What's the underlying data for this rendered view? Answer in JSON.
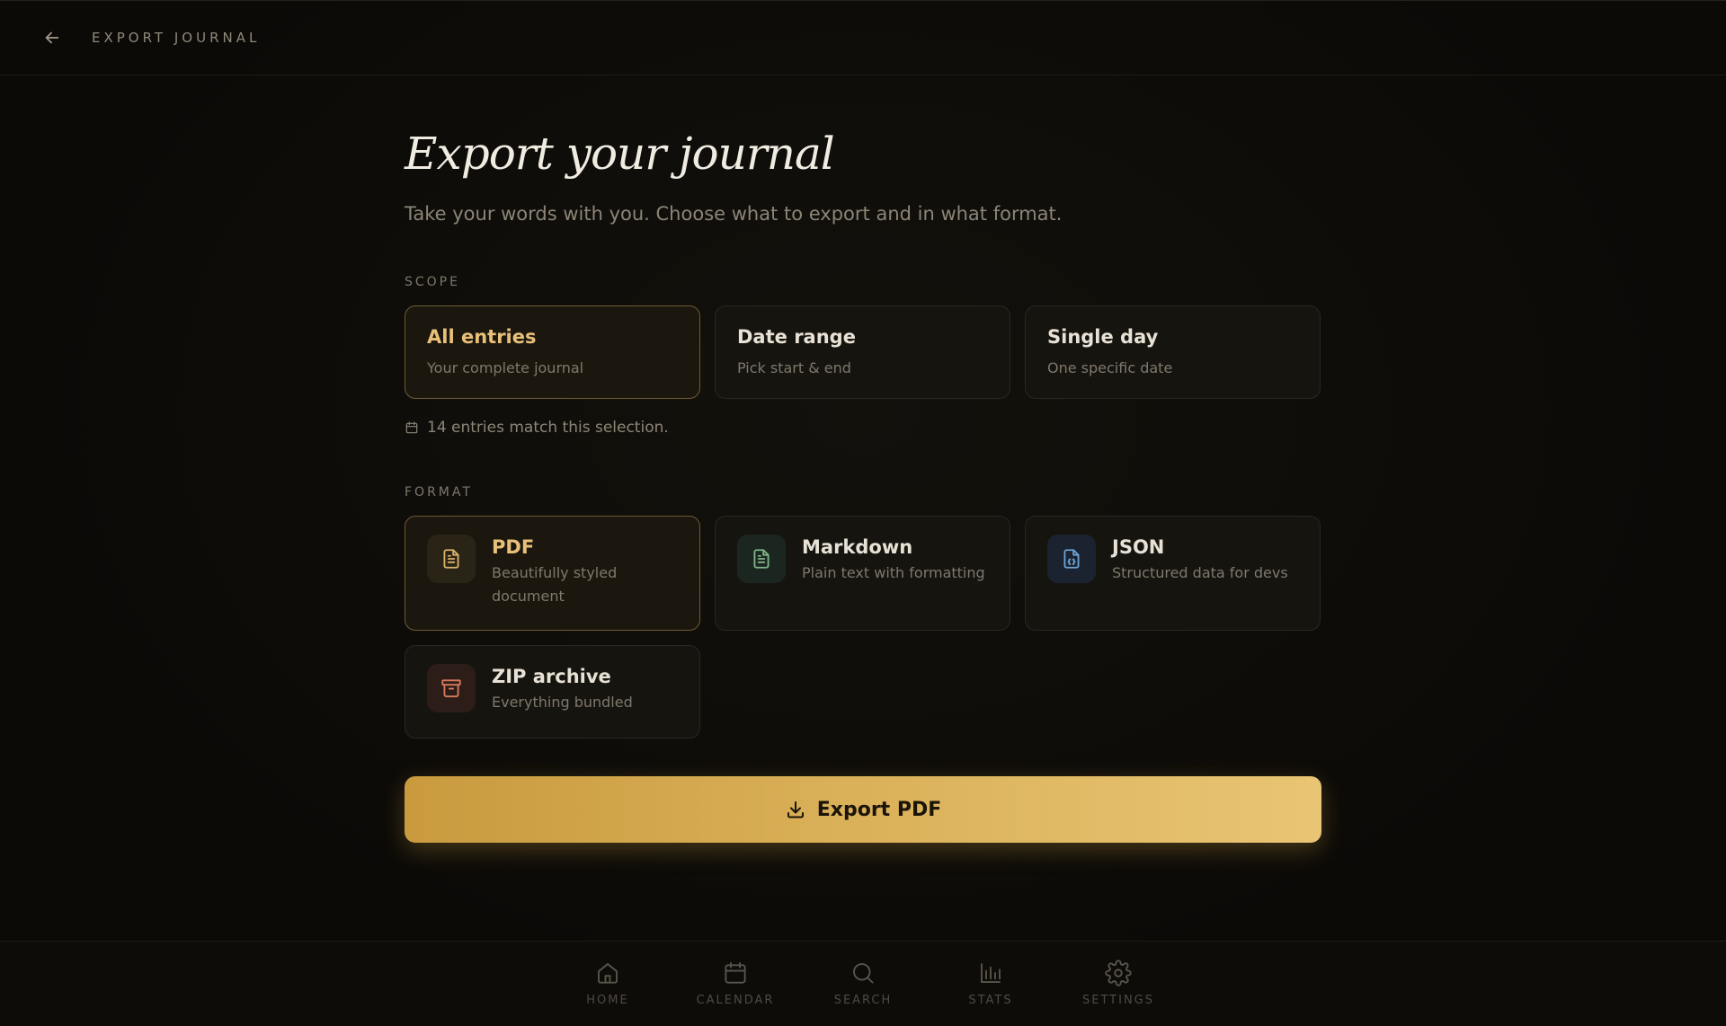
{
  "header": {
    "title": "EXPORT JOURNAL",
    "back_icon": "arrow-left-icon"
  },
  "main": {
    "title": "Export your journal",
    "subtitle": "Take your words with you. Choose what to export and in what format."
  },
  "scope": {
    "label": "SCOPE",
    "options": [
      {
        "title": "All entries",
        "desc": "Your complete journal",
        "selected": true
      },
      {
        "title": "Date range",
        "desc": "Pick start & end",
        "selected": false
      },
      {
        "title": "Single day",
        "desc": "One specific date",
        "selected": false
      }
    ],
    "match_text": "14 entries match this selection."
  },
  "format": {
    "label": "FORMAT",
    "options": [
      {
        "title": "PDF",
        "desc": "Beautifully styled document",
        "icon": "document-icon",
        "color": "#d9b36a",
        "icon_bg": "#2a2417",
        "selected": true
      },
      {
        "title": "Markdown",
        "desc": "Plain text with formatting",
        "icon": "document-text-icon",
        "color": "#7fb48a",
        "icon_bg": "#1c2620",
        "selected": false
      },
      {
        "title": "JSON",
        "desc": "Structured data for devs",
        "icon": "code-file-icon",
        "color": "#6ea2d4",
        "icon_bg": "#1b2330",
        "selected": false
      },
      {
        "title": "ZIP archive",
        "desc": "Everything bundled",
        "icon": "archive-icon",
        "color": "#d97a5e",
        "icon_bg": "#2c1d18",
        "selected": false
      }
    ]
  },
  "export_button": {
    "label": "Export PDF",
    "icon": "download-icon"
  },
  "nav": {
    "items": [
      {
        "label": "HOME",
        "icon": "home-icon"
      },
      {
        "label": "CALENDAR",
        "icon": "calendar-icon"
      },
      {
        "label": "SEARCH",
        "icon": "search-icon"
      },
      {
        "label": "STATS",
        "icon": "bar-chart-icon"
      },
      {
        "label": "SETTINGS",
        "icon": "gear-icon"
      }
    ]
  },
  "colors": {
    "accent": "#d9b36a",
    "background": "#0d0b08",
    "card": "#16140f"
  }
}
